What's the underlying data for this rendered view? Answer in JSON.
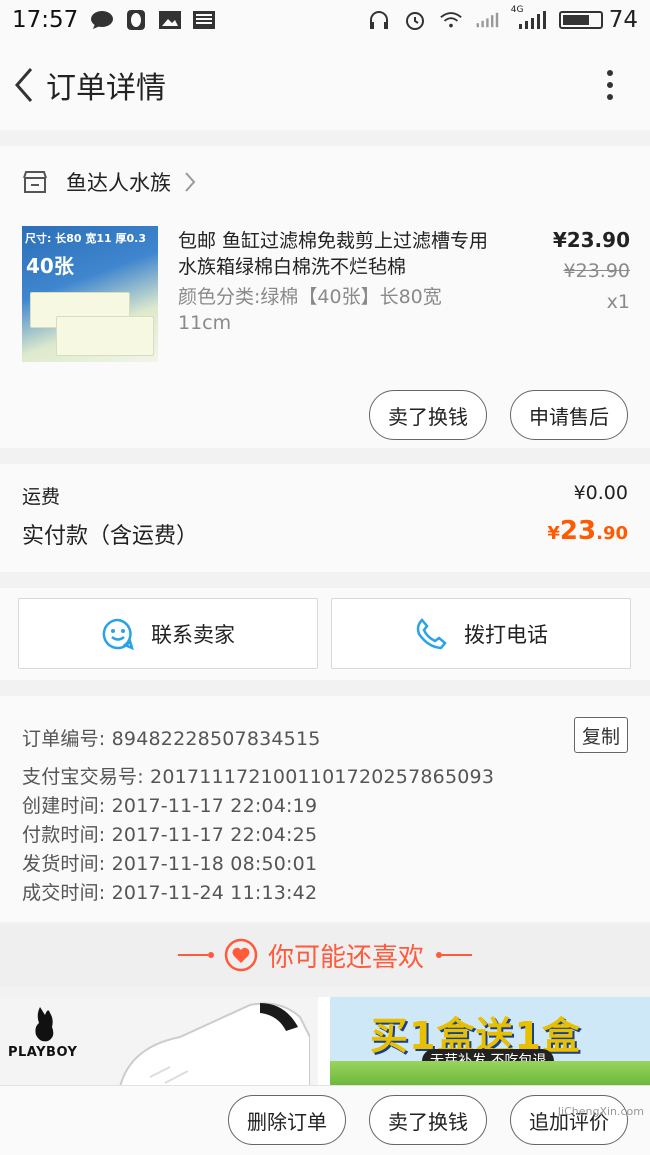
{
  "status_bar": {
    "time": "17:57",
    "battery_pct": "74",
    "battery_level": 0.74,
    "net_label": "4G",
    "icons": [
      "chat-bubble-icon",
      "qq-penguin-icon",
      "image-icon",
      "news-icon",
      "headset-icon",
      "alarm-icon",
      "wifi-icon",
      "signal-icon",
      "signal-4g-icon",
      "battery-icon"
    ]
  },
  "header": {
    "title": "订单详情"
  },
  "shop": {
    "name": "鱼达人水族"
  },
  "product": {
    "title": "包邮 鱼缸过滤棉免裁剪上过滤槽专用水族箱绿棉白棉洗不烂毡棉",
    "sku": "颜色分类:绿棉【40张】长80宽11cm",
    "price": "¥23.90",
    "original_price": "¥23.90",
    "quantity": "x1",
    "thumb_text1": "尺寸: 长80 宽11 厚0.3",
    "thumb_text2": "40张"
  },
  "product_actions": {
    "sell": "卖了换钱",
    "after_sale": "申请售后"
  },
  "totals": {
    "shipping_label": "运费",
    "shipping_value": "¥0.00",
    "paid_label": "实付款（含运费）",
    "paid_currency": "¥",
    "paid_int": "23",
    "paid_dec": ".90"
  },
  "contact": {
    "seller": "联系卖家",
    "phone": "拨打电话"
  },
  "order_info": {
    "order_no": "订单编号: 89482228507834515",
    "copy_label": "复制",
    "alipay_no": "支付宝交易号: 2017111721001101720257865093",
    "created": "创建时间: 2017-11-17 22:04:19",
    "paid": "付款时间: 2017-11-17 22:04:25",
    "shipped": "发货时间: 2017-11-18 08:50:01",
    "completed": "成交时间: 2017-11-24 11:13:42"
  },
  "recommend": {
    "title": "你可能还喜欢",
    "item1_brand": "PLAYBOY",
    "item2_title": "买1盒送1盒",
    "item2_sub": "无芽补发 不吃包退"
  },
  "bottom_actions": {
    "delete": "删除订单",
    "sell": "卖了换钱",
    "review": "追加评价"
  },
  "watermark": "JiChengXin.com",
  "colors": {
    "accent": "#ff5a00",
    "recommend": "#ff5a3c",
    "contact_icon": "#29a3e6"
  }
}
